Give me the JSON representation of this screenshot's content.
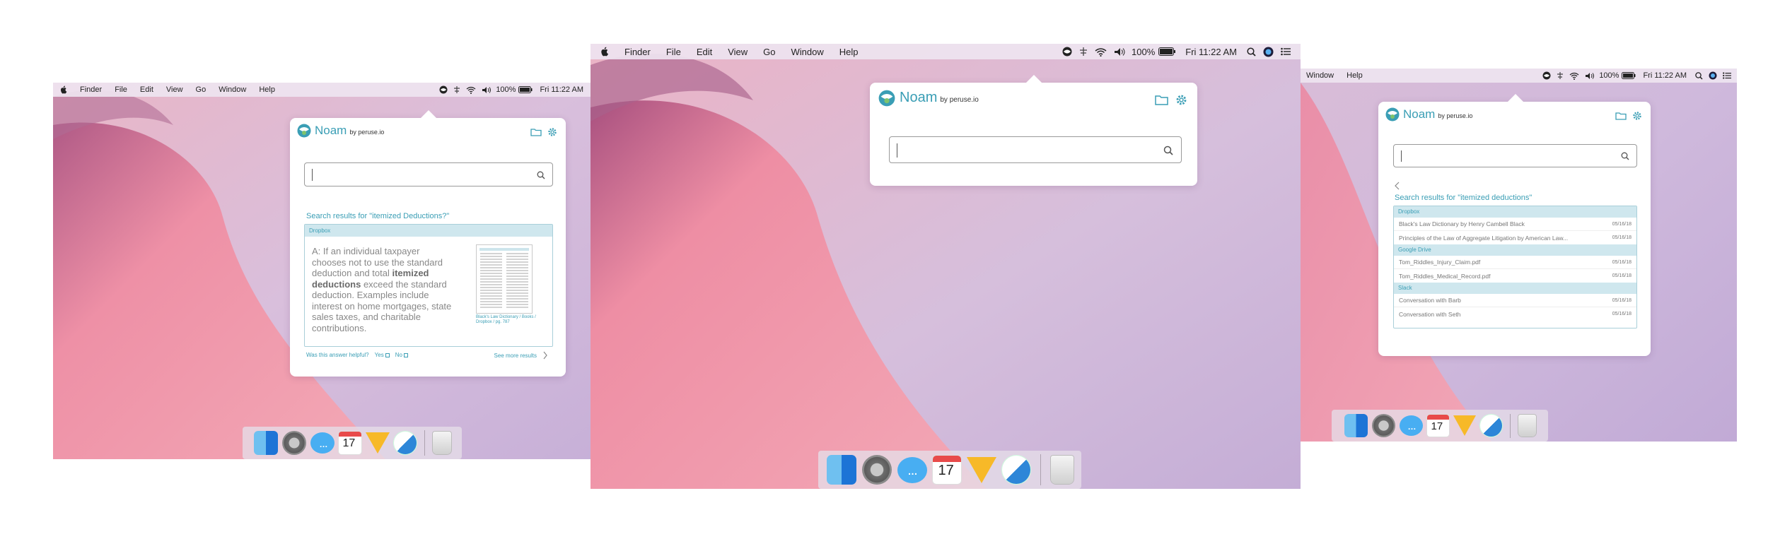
{
  "menubar": {
    "left": [
      "Finder",
      "File",
      "Edit",
      "View",
      "Go",
      "Window",
      "Help"
    ],
    "left_right_panel": [
      "Window",
      "Help"
    ],
    "battery": "100%",
    "clock": "Fri 11:22 AM"
  },
  "noam": {
    "name": "Noam",
    "by": "by peruse.io",
    "search_value": ""
  },
  "left_panel": {
    "results_title": "Search results for \"itemized Deductions?\"",
    "source": "Dropbox",
    "answer_pre": "A: If an individual taxpayer chooses not to use the standard deduction and total ",
    "answer_bold_1": "itemized",
    "answer_mid": " ",
    "answer_bold_2": "deductions",
    "answer_post": " exceed the standard deduction. Examples include interest on home mortgages, state sales taxes, and charitable contributions.",
    "doc_caption": "Black's Law Dictionary / Books / Dropbox / pg. 787",
    "helpful_question": "Was this answer helpful?",
    "yes": "Yes",
    "no": "No",
    "see_more": "See more results"
  },
  "right_panel": {
    "results_title": "Search results for \"itemized deductions\"",
    "groups": [
      {
        "source": "Dropbox",
        "items": [
          {
            "title": "Black's Law Dictionary by Henry Cambell Black",
            "date": "05/16/18"
          },
          {
            "title": "Principles of the Law of Aggregate Litigation by American Law...",
            "date": "05/16/18"
          }
        ]
      },
      {
        "source": "Google Drive",
        "items": [
          {
            "title": "Tom_Riddles_Injury_Claim.pdf",
            "date": "05/16/18"
          },
          {
            "title": "Tom_Riddles_Medical_Record.pdf",
            "date": "05/16/18"
          }
        ]
      },
      {
        "source": "Slack",
        "items": [
          {
            "title": "Conversation with Barb",
            "date": "05/16/18"
          },
          {
            "title": "Conversation with Seth",
            "date": "05/16/18"
          }
        ]
      }
    ]
  },
  "dock": {
    "icons": [
      "finder-icon",
      "system-preferences-icon",
      "messages-icon",
      "calendar-icon",
      "sketch-icon",
      "noam-app-icon",
      "trash-icon"
    ],
    "calendar_day": "17"
  },
  "colors": {
    "accent": "#3a9eb5",
    "group_header_bg": "#cfe7ee",
    "wallpaper_pink": "#ee8ea4",
    "wallpaper_lavender": "#c9b3d6"
  }
}
